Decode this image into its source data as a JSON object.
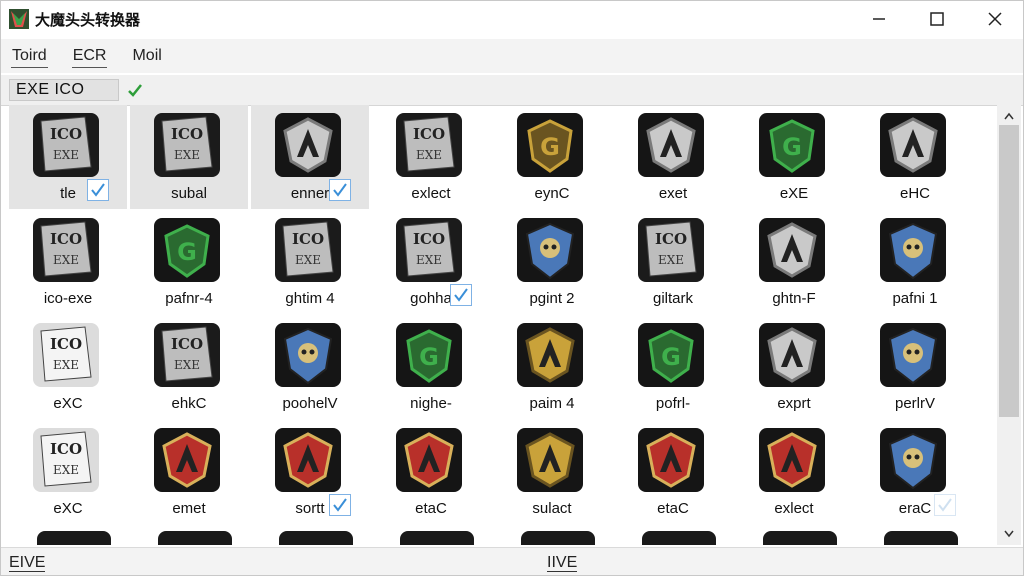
{
  "window": {
    "title": "大魔头头转换器",
    "controls": [
      "minimize-icon",
      "maximize-icon",
      "close-icon"
    ]
  },
  "menu": {
    "items": [
      {
        "label": "Toird"
      },
      {
        "label": "ECR"
      },
      {
        "label": "Moil"
      }
    ]
  },
  "toolbar": {
    "format_label": "EXE  ICO",
    "accept_icon": "check-icon"
  },
  "grid": {
    "rows": [
      [
        {
          "label": "tle",
          "icon": "ico-exe-doc",
          "tint": "gray",
          "selected": true,
          "checked": true
        },
        {
          "label": "subal",
          "icon": "ico-exe-doc",
          "tint": "gray",
          "selected": true,
          "checked": false
        },
        {
          "label": "enner",
          "icon": "shield-a",
          "tint": "silver",
          "selected": true,
          "checked": true
        },
        {
          "label": "exlect",
          "icon": "ico-exe-doc",
          "tint": "gray",
          "selected": false,
          "checked": false
        },
        {
          "label": "eynC",
          "icon": "shield-g",
          "tint": "gold",
          "selected": false,
          "checked": false
        },
        {
          "label": "exet",
          "icon": "shield-a",
          "tint": "silver",
          "selected": false,
          "checked": false
        },
        {
          "label": "eXE",
          "icon": "shield-g",
          "tint": "green",
          "selected": false,
          "checked": false
        },
        {
          "label": "eHC",
          "icon": "shield-a",
          "tint": "silver",
          "selected": false,
          "checked": false
        }
      ],
      [
        {
          "label": "ico-exe",
          "icon": "ico-exe-doc",
          "tint": "gray",
          "selected": false,
          "checked": false
        },
        {
          "label": "pafnr-4",
          "icon": "shield-g",
          "tint": "green",
          "selected": false,
          "checked": false
        },
        {
          "label": "ghtim 4",
          "icon": "ico-exe-doc",
          "tint": "gray",
          "selected": false,
          "checked": false
        },
        {
          "label": "gohha",
          "icon": "ico-exe-doc",
          "tint": "gray",
          "selected": false,
          "checked": true
        },
        {
          "label": "pgint 2",
          "icon": "shield-skull",
          "tint": "blue",
          "selected": false,
          "checked": false
        },
        {
          "label": "giltark",
          "icon": "ico-exe-doc",
          "tint": "gray",
          "selected": false,
          "checked": false
        },
        {
          "label": "ghtn-F",
          "icon": "shield-a",
          "tint": "silver",
          "selected": false,
          "checked": false
        },
        {
          "label": "pafni 1",
          "icon": "shield-skull",
          "tint": "blue",
          "selected": false,
          "checked": false
        }
      ],
      [
        {
          "label": "eXC",
          "icon": "ico-exe-doc",
          "tint": "light",
          "selected": false,
          "checked": false
        },
        {
          "label": "ehkC",
          "icon": "ico-exe-doc",
          "tint": "gray",
          "selected": false,
          "checked": false
        },
        {
          "label": "poohelV",
          "icon": "shield-skull",
          "tint": "blue",
          "selected": false,
          "checked": false
        },
        {
          "label": "nighe-",
          "icon": "shield-g",
          "tint": "green",
          "selected": false,
          "checked": false
        },
        {
          "label": "paim 4",
          "icon": "shield-a",
          "tint": "gold",
          "selected": false,
          "checked": false
        },
        {
          "label": "pofrl-",
          "icon": "shield-g",
          "tint": "green",
          "selected": false,
          "checked": false
        },
        {
          "label": "exprt",
          "icon": "shield-a",
          "tint": "silver",
          "selected": false,
          "checked": false
        },
        {
          "label": "perlrV",
          "icon": "shield-skull",
          "tint": "blue",
          "selected": false,
          "checked": false
        }
      ],
      [
        {
          "label": "eXC",
          "icon": "ico-exe-doc",
          "tint": "light",
          "selected": false,
          "checked": false
        },
        {
          "label": "emet",
          "icon": "shield-a",
          "tint": "red",
          "selected": false,
          "checked": false
        },
        {
          "label": "sortt",
          "icon": "shield-a",
          "tint": "red",
          "selected": false,
          "checked": true
        },
        {
          "label": "etaC",
          "icon": "shield-a",
          "tint": "red",
          "selected": false,
          "checked": false
        },
        {
          "label": "sulact",
          "icon": "shield-a",
          "tint": "gold",
          "selected": false,
          "checked": false
        },
        {
          "label": "etaC",
          "icon": "shield-a",
          "tint": "red",
          "selected": false,
          "checked": false
        },
        {
          "label": "exlect",
          "icon": "shield-a",
          "tint": "red",
          "selected": false,
          "checked": false
        },
        {
          "label": "eraC",
          "icon": "shield-skull",
          "tint": "blue",
          "selected": false,
          "checked": "faint"
        }
      ]
    ]
  },
  "status": {
    "left": "EIVE",
    "center": "IIVE"
  },
  "colors": {
    "check": "#3a8fd8",
    "accept": "#2e9e3a",
    "selected_bg": "#e4e4e4"
  }
}
